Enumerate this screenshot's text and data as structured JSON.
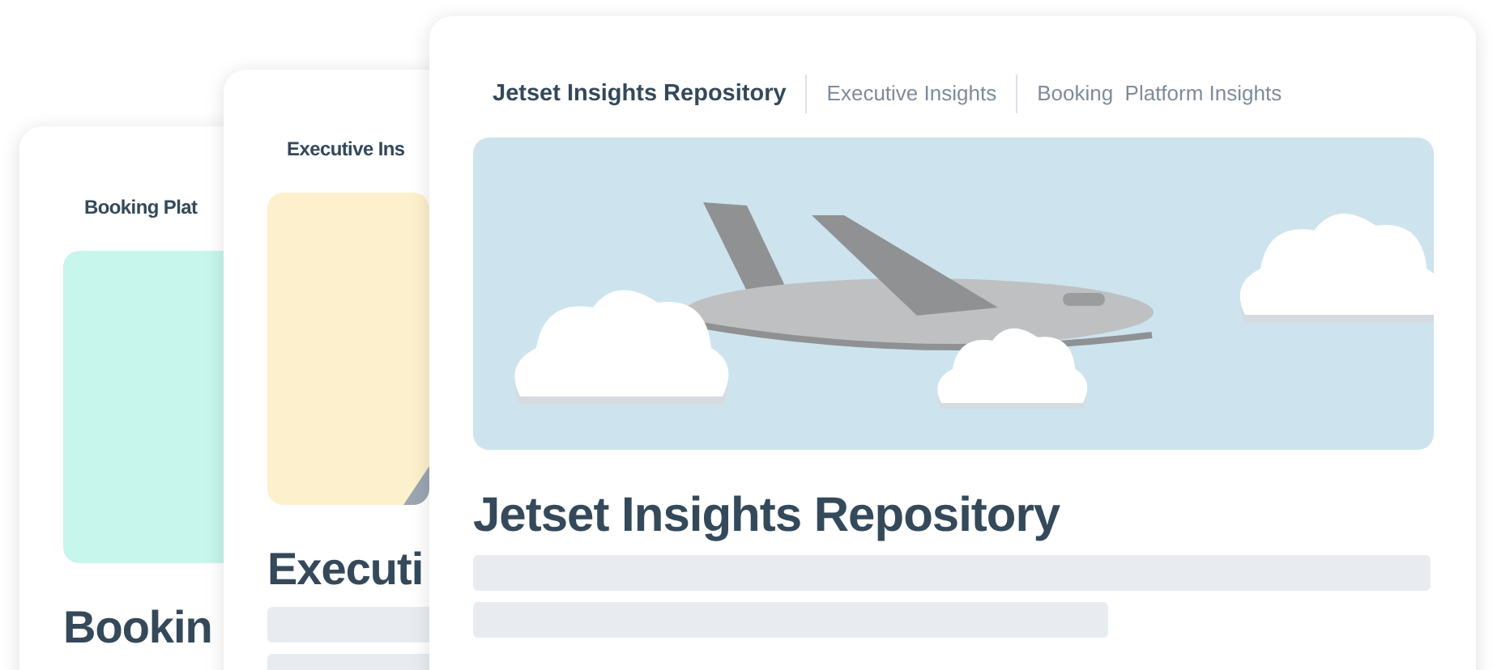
{
  "cards": [
    {
      "tabs": [
        {
          "label": "Booking Plat",
          "selected": true
        }
      ],
      "hero": {
        "kind": "blank",
        "color": "#c6f6ec"
      },
      "title": "Bookin",
      "skeleton": false
    },
    {
      "tabs": [
        {
          "label": "Executive Ins",
          "selected": true
        }
      ],
      "hero": {
        "kind": "wing-corner",
        "color": "#fdf0cc"
      },
      "title": "Executi",
      "skeleton": true
    },
    {
      "tabs": [
        {
          "label": "Jetset Insights Repository",
          "selected": true
        },
        {
          "label": "Executive Insights",
          "selected": false
        },
        {
          "label": "Booking  Platform Insights",
          "selected": false
        }
      ],
      "hero": {
        "kind": "plane",
        "color": "#cde4ee"
      },
      "title": "Jetset Insights Repository",
      "skeleton": true
    }
  ]
}
